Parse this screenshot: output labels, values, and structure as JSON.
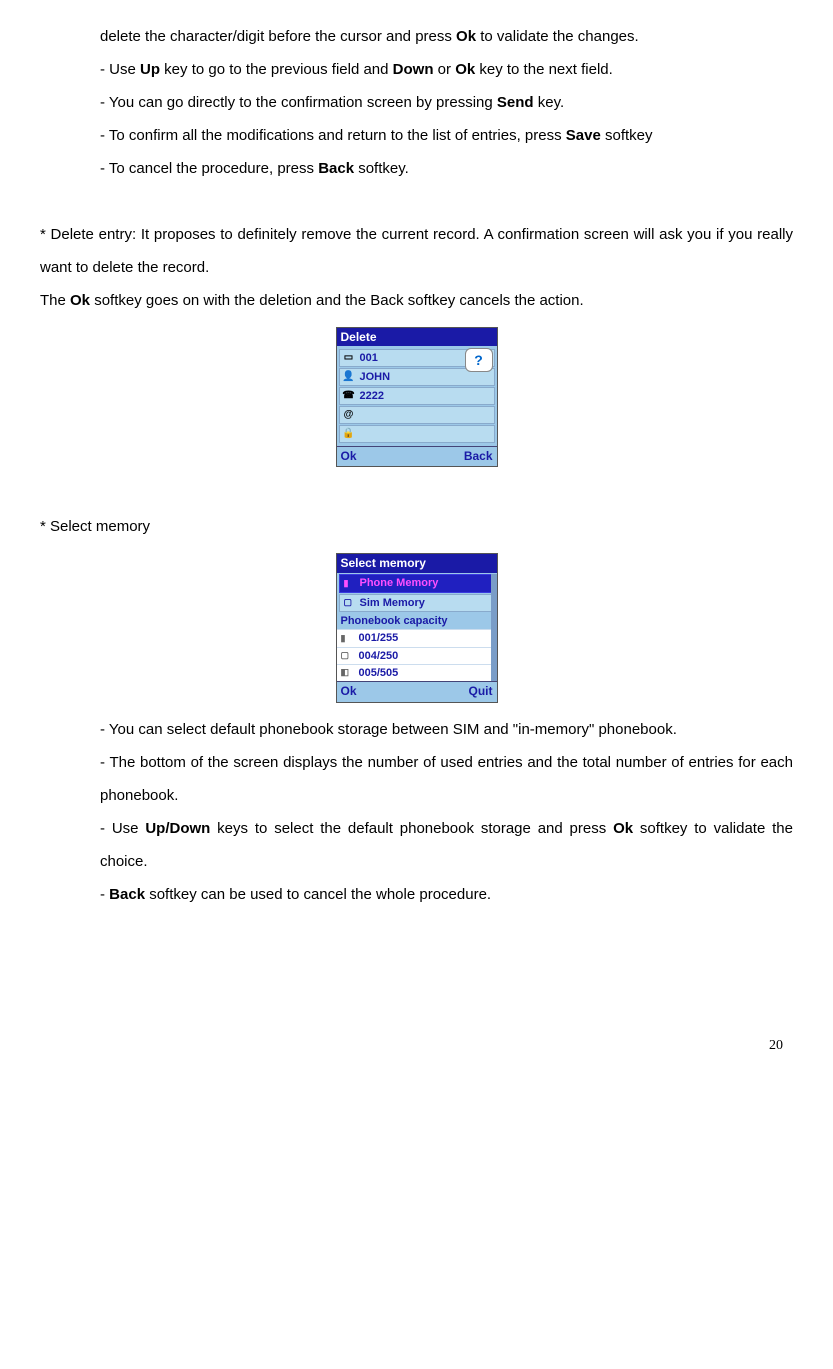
{
  "para1_a": "delete the character/digit before the cursor and press ",
  "para1_b": "Ok",
  "para1_c": " to validate the changes.",
  "line2_a": "- Use ",
  "line2_b": "Up",
  "line2_c": " key to go to the previous field and ",
  "line2_d": "Down",
  "line2_e": " or ",
  "line2_f": "Ok",
  "line2_g": " key to the next field.",
  "line3_a": "- You can go directly to the confirmation screen by pressing ",
  "line3_b": "Send",
  "line3_c": " key.",
  "line4_a": "- To confirm all the modifications and return to the list of entries, press ",
  "line4_b": "Save",
  "line4_c": " softkey",
  "line5_a": "- To cancel the procedure, press ",
  "line5_b": "Back",
  "line5_c": " softkey.",
  "delete_para": "* Delete entry: It proposes to definitely remove the current record. A confirmation screen will ask you if you really want to delete the record.",
  "delete_ok_a": "The ",
  "delete_ok_b": "Ok",
  "delete_ok_c": " softkey goes on with the deletion and the Back softkey cancels the action.",
  "screen1": {
    "title": "Delete",
    "row1": "001",
    "row2": "JOHN",
    "row3": "2222",
    "sk_left": "Ok",
    "sk_right": "Back",
    "bubble": "?"
  },
  "select_memory_heading": "* Select memory",
  "screen2": {
    "title": "Select memory",
    "opt1": "Phone Memory",
    "opt2": "Sim Memory",
    "cap_label": "Phonebook capacity",
    "cap1": "001/255",
    "cap2": "004/250",
    "cap3": "005/505",
    "sk_left": "Ok",
    "sk_right": "Quit"
  },
  "sm1": "- You can select default phonebook storage between SIM and \"in-memory\" phonebook.",
  "sm2": "- The bottom of the screen displays the number of used entries and the total number of entries for each phonebook.",
  "sm3_a": "- Use ",
  "sm3_b": "Up/Down",
  "sm3_c": " keys to select the default phonebook storage and press ",
  "sm3_d": "Ok",
  "sm3_e": " softkey to validate the choice.",
  "sm4_a": "- ",
  "sm4_b": "Back",
  "sm4_c": " softkey can be used to cancel the whole procedure.",
  "page_number": "20"
}
